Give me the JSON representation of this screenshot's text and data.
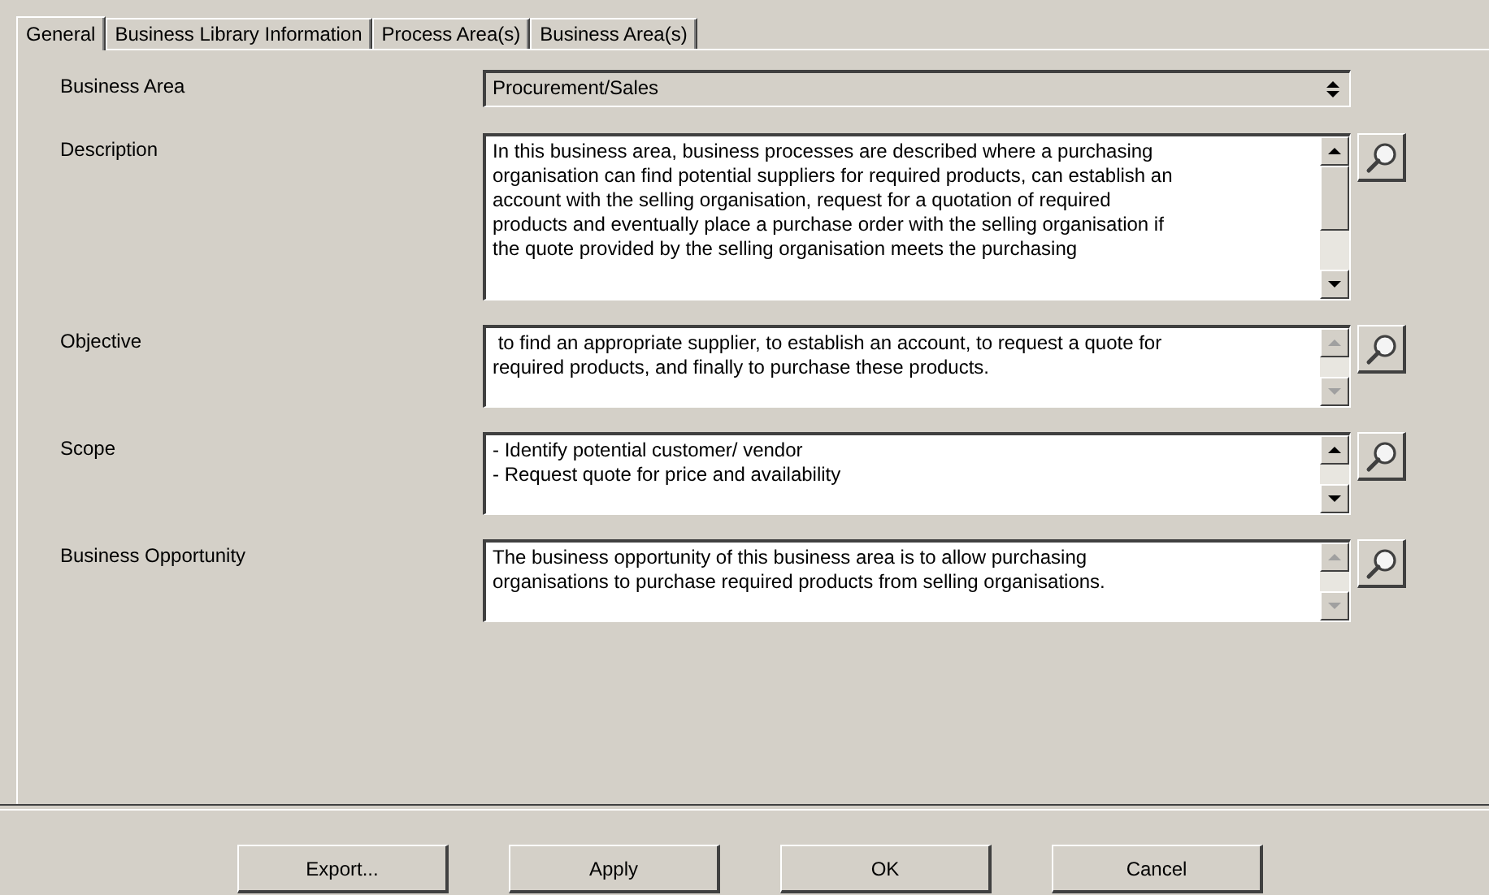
{
  "tabs": [
    {
      "label": "General",
      "selected": true
    },
    {
      "label": "Business Library Information",
      "selected": false
    },
    {
      "label": "Process Area(s)",
      "selected": false
    },
    {
      "label": "Business Area(s)",
      "selected": false
    }
  ],
  "business_area": {
    "label": "Business Area",
    "value": "Procurement/Sales"
  },
  "text_fields": [
    {
      "label": "Description",
      "value": "In this business area, business processes are described where a purchasing\norganisation can find potential suppliers for required products, can establish an\naccount with the selling organisation, request for a quotation of required\nproducts and eventually place a purchase order with the selling organisation if\nthe quote provided by the selling organisation meets the purchasing",
      "scrollable": true
    },
    {
      "label": "Objective",
      "value": " to find an appropriate supplier, to establish an account, to request a quote for\nrequired products, and finally to purchase these products.",
      "scrollable": false
    },
    {
      "label": "Scope",
      "value": "- Identify potential customer/ vendor\n- Request quote for price and availability",
      "scrollable": true
    },
    {
      "label": "Business Opportunity",
      "value": "The business opportunity of this business area is to allow purchasing\norganisations to purchase required products from selling organisations.",
      "scrollable": false
    }
  ],
  "buttons": [
    "Export...",
    "Apply",
    "OK",
    "Cancel"
  ]
}
